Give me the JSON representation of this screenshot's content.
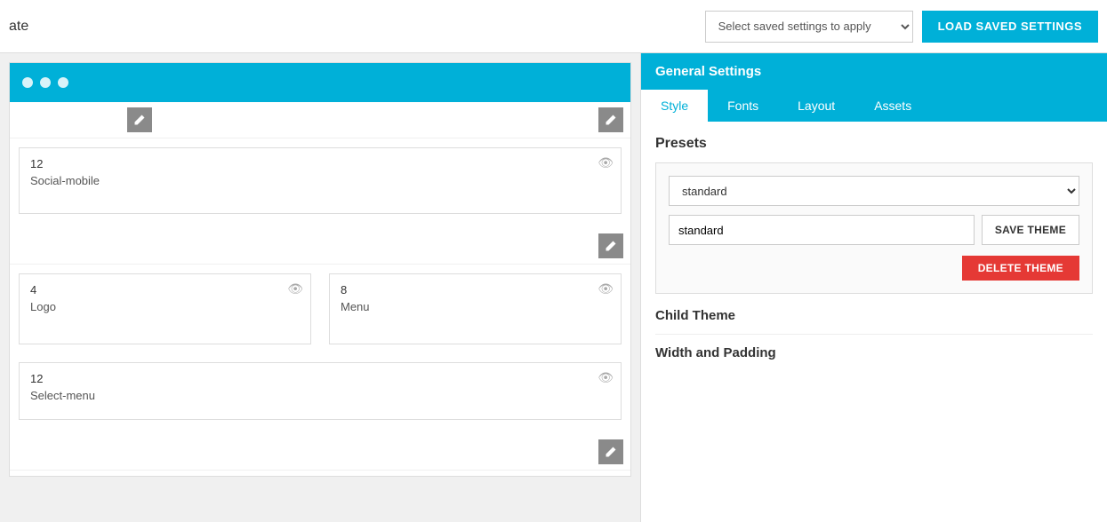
{
  "topbar": {
    "title": "ate",
    "select_placeholder": "Select saved settings to apply",
    "load_btn_label": "LOAD SAVED SETTINGS"
  },
  "left": {
    "browser_dots": [
      "dot1",
      "dot2",
      "dot3"
    ],
    "section1": {
      "edit_icon": "✎",
      "widget": {
        "number": "12",
        "label": "Social-mobile",
        "eye_icon": "👁"
      }
    },
    "section2": {
      "edit_icon": "✎",
      "widgets": [
        {
          "number": "4",
          "label": "Logo"
        },
        {
          "number": "8",
          "label": "Menu"
        }
      ],
      "widget_bottom": {
        "number": "12",
        "label": "Select-menu"
      }
    }
  },
  "right": {
    "panel_title": "General Settings",
    "tabs": [
      {
        "label": "Style",
        "active": true
      },
      {
        "label": "Fonts",
        "active": false
      },
      {
        "label": "Layout",
        "active": false
      },
      {
        "label": "Assets",
        "active": false
      }
    ],
    "presets_title": "Presets",
    "presets_select_options": [
      "standard"
    ],
    "presets_select_value": "standard",
    "preset_name_value": "standard",
    "save_theme_btn": "SAVE THEME",
    "delete_theme_btn": "DELETE THEME",
    "child_theme_title": "Child Theme",
    "width_padding_title": "Width and Padding"
  }
}
